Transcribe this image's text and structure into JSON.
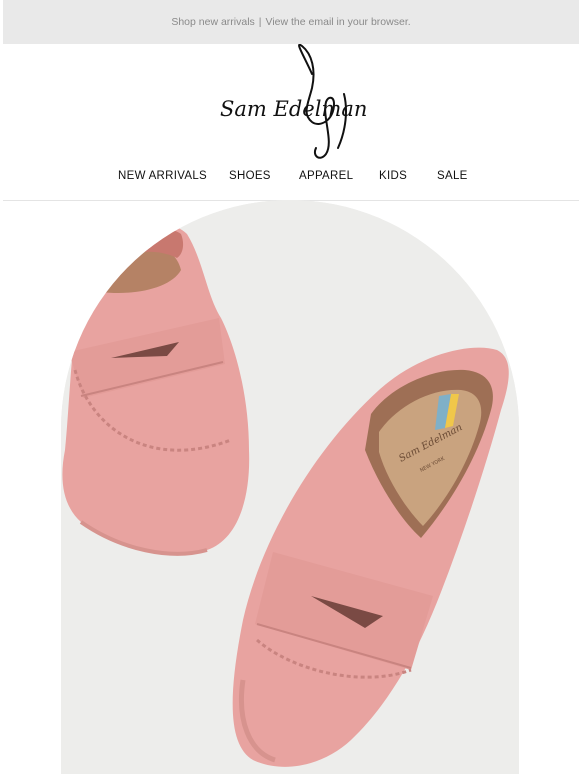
{
  "preheader": {
    "shop_link": "Shop new arrivals",
    "separator": "|",
    "browser_link": "View the email in your browser."
  },
  "brand": {
    "logo_text": "Sam Edelman"
  },
  "nav": {
    "items": [
      {
        "label": "NEW ARRIVALS"
      },
      {
        "label": "SHOES"
      },
      {
        "label": "APPAREL"
      },
      {
        "label": "KIDS"
      },
      {
        "label": "SALE"
      }
    ]
  },
  "hero": {
    "insole_brand": "Sam Edelman",
    "insole_city": "NEW YORK",
    "product_color": "#e8a3a0",
    "background_color": "#ededeb"
  }
}
